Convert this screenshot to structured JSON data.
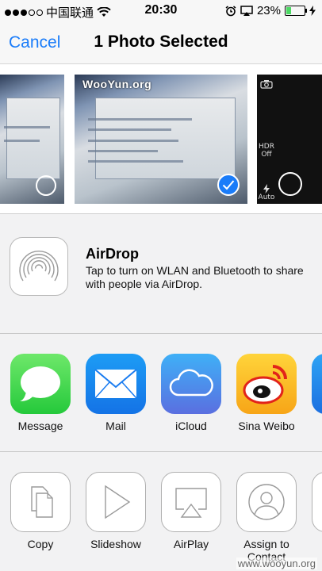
{
  "status_bar": {
    "carrier": "中国联通",
    "time": "20:30",
    "battery_percent": "23%",
    "battery_level": 0.23,
    "signal_bars_filled": 3,
    "icons": [
      "wifi-icon",
      "alarm-icon",
      "airplay-icon",
      "charging-icon"
    ]
  },
  "nav": {
    "cancel_label": "Cancel",
    "title": "1 Photo Selected"
  },
  "photos": {
    "watermark": "WooYun.org",
    "items": [
      {
        "selected": false
      },
      {
        "selected": true
      },
      {
        "selected": false
      }
    ],
    "camera": {
      "hdr_label": "HDR\nOff",
      "flash_label": "Auto"
    }
  },
  "airdrop": {
    "title": "AirDrop",
    "description": "Tap to turn on WLAN and Bluetooth to share with people via AirDrop."
  },
  "share_apps": [
    {
      "label": "Message",
      "icon": "message-icon"
    },
    {
      "label": "Mail",
      "icon": "mail-icon"
    },
    {
      "label": "iCloud",
      "icon": "icloud-icon"
    },
    {
      "label": "Sina Weibo",
      "icon": "weibo-icon"
    }
  ],
  "actions": [
    {
      "label": "Copy",
      "icon": "copy-icon"
    },
    {
      "label": "Slideshow",
      "icon": "play-icon"
    },
    {
      "label": "AirPlay",
      "icon": "airplay-icon"
    },
    {
      "label": "Assign to\nContact",
      "icon": "contact-icon"
    }
  ],
  "footer_watermark": "www.wooyun.org",
  "colors": {
    "accent": "#1a7cf9",
    "message_green": "#4cd964",
    "battery_green": "#4cd964"
  }
}
